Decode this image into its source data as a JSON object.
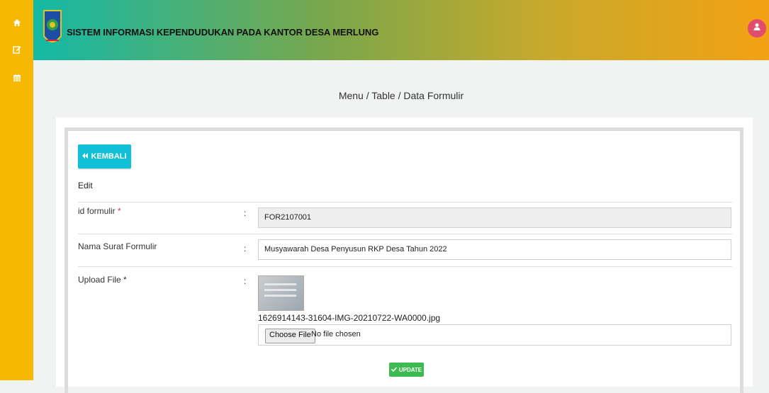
{
  "sidebar": {
    "items": [
      {
        "icon": "home-icon"
      },
      {
        "icon": "edit-icon"
      },
      {
        "icon": "calendar-icon"
      }
    ]
  },
  "header": {
    "title": "SISTEM INFORMASI KEPENDUDUKAN PADA KANTOR DESA MERLUNG",
    "user_icon": "user-icon"
  },
  "breadcrumb": "Menu / Table / Data Formulir",
  "form": {
    "back_label": "KEMBALI",
    "section_title": "Edit",
    "fields": {
      "id": {
        "label": "id formulir",
        "required_mark": "*",
        "value": "FOR2107001"
      },
      "nama": {
        "label": "Nama Surat Formulir",
        "value": "Musyawarah Desa Penyusun RKP Desa Tahun 2022"
      },
      "upload": {
        "label": "Upload File *",
        "filename": "1626914143-31604-IMG-20210722-WA0000.jpg",
        "choose_label": "Choose File",
        "no_file_text": "No file chosen"
      }
    },
    "colon": ":",
    "update_label": "UPDATE"
  },
  "colors": {
    "sidebar": "#f6b800",
    "back_button": "#11c0d6",
    "update_button": "#3dbb52",
    "user_button": "#e24d6b"
  }
}
